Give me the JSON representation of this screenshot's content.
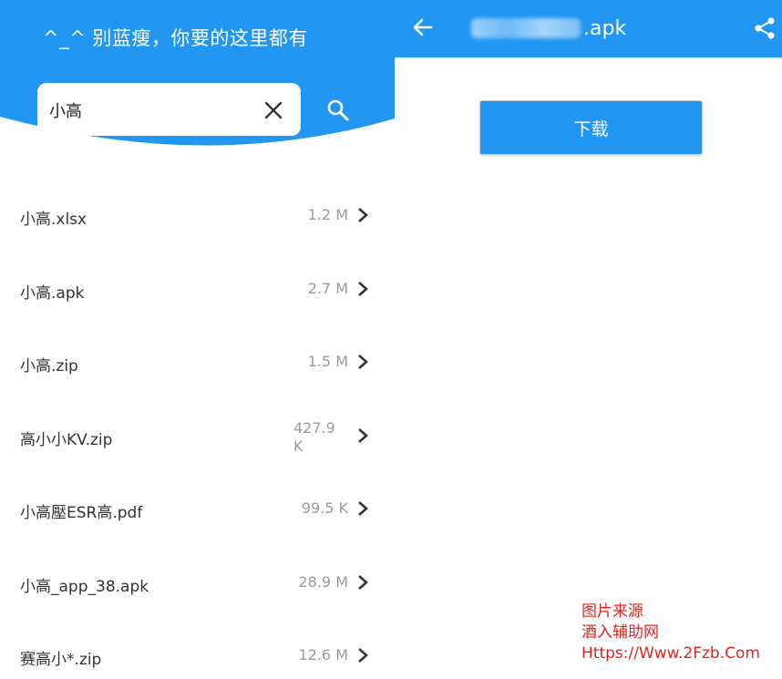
{
  "left": {
    "slogan": "^_^ 别蓝瘦，你要的这里都有",
    "search": {
      "value": "小高"
    },
    "files": [
      {
        "name": "小高.xlsx",
        "size": "1.2 M"
      },
      {
        "name": "小高.apk",
        "size": "2.7 M"
      },
      {
        "name": "小高.zip",
        "size": "1.5 M"
      },
      {
        "name": "高小小KV.zip",
        "size": "427.9 K"
      },
      {
        "name": "小高壓ESR高.pdf",
        "size": "99.5 K"
      },
      {
        "name": "小高_app_38.apk",
        "size": "28.9 M"
      },
      {
        "name": "赛高小*.zip",
        "size": "12.6 M"
      }
    ]
  },
  "right": {
    "title_suffix": ".apk",
    "download_label": "下载"
  },
  "watermark": {
    "line1": "图片来源",
    "line2": "酒入辅助网",
    "line3": "Https://Www.2Fzb.Com"
  },
  "colors": {
    "accent": "#2196f3",
    "watermark": "#e8231c"
  },
  "icons": [
    "clear-icon",
    "search-icon",
    "chevron-right-icon",
    "back-arrow-icon",
    "share-icon"
  ]
}
